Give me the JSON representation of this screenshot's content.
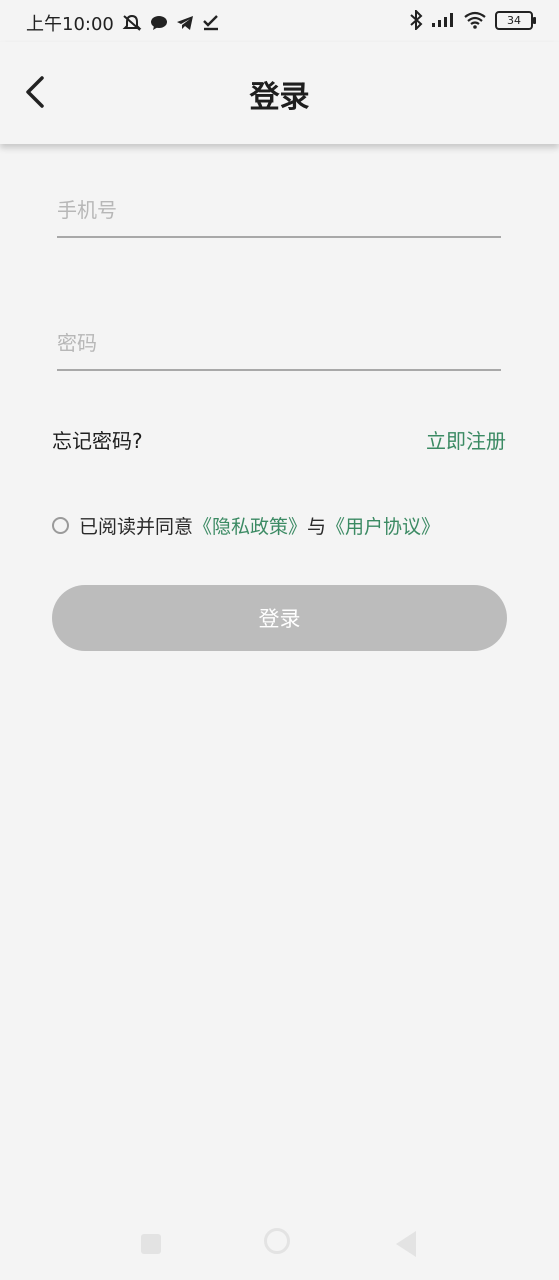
{
  "status_bar": {
    "time": "上午10:00",
    "battery": "34"
  },
  "header": {
    "title": "登录"
  },
  "form": {
    "phone_placeholder": "手机号",
    "password_placeholder": "密码",
    "forgot_password": "忘记密码?",
    "register": "立即注册",
    "agree_prefix": "已阅读并同意",
    "privacy_link": "《隐私政策》",
    "and_text": "与",
    "terms_link": "《用户协议》",
    "login_button": "登录"
  },
  "colors": {
    "accent": "#3b8a63",
    "button_disabled": "#bcbcbc",
    "background": "#f4f4f4"
  },
  "icons": [
    "back-arrow-icon",
    "mute-icon",
    "chat-icon",
    "telegram-icon",
    "check-icon",
    "bluetooth-icon",
    "signal-icon",
    "wifi-icon",
    "battery-icon"
  ]
}
